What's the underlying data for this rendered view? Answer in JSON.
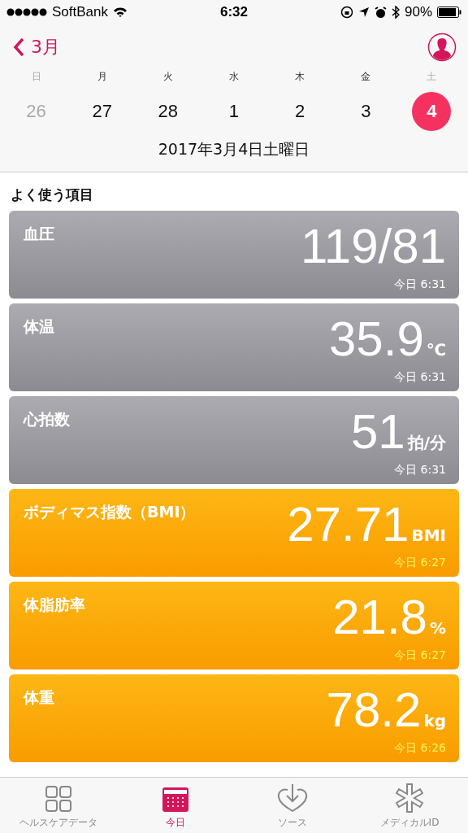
{
  "status_bar": {
    "carrier": "SoftBank",
    "time": "6:32",
    "battery": "90%"
  },
  "nav": {
    "back": "3月"
  },
  "week": [
    {
      "weekday": "日",
      "date": "26",
      "weekend": true,
      "other_month": true,
      "selected": false
    },
    {
      "weekday": "月",
      "date": "27",
      "weekend": false,
      "other_month": false,
      "selected": false
    },
    {
      "weekday": "火",
      "date": "28",
      "weekend": false,
      "other_month": false,
      "selected": false
    },
    {
      "weekday": "水",
      "date": "1",
      "weekend": false,
      "other_month": false,
      "selected": false
    },
    {
      "weekday": "木",
      "date": "2",
      "weekend": false,
      "other_month": false,
      "selected": false
    },
    {
      "weekday": "金",
      "date": "3",
      "weekend": false,
      "other_month": false,
      "selected": false
    },
    {
      "weekday": "土",
      "date": "4",
      "weekend": true,
      "other_month": false,
      "selected": true
    }
  ],
  "selected_date": "2017年3月4日土曜日",
  "section_title": "よく使う項目",
  "cards": [
    {
      "kind": "vitals",
      "title": "血圧",
      "value": "119/81",
      "time": "今日 6:31"
    },
    {
      "kind": "vitals",
      "title": "体温",
      "value": "35.9",
      "unit": "℃",
      "time": "今日 6:31"
    },
    {
      "kind": "vitals",
      "title": "心拍数",
      "value": "51",
      "unit": "拍/分",
      "time": "今日 6:31"
    },
    {
      "kind": "body",
      "title": "ボディマス指数（BMI）",
      "value": "27.71",
      "unit": "BMI",
      "time": "今日 6:27"
    },
    {
      "kind": "body",
      "title": "体脂肪率",
      "value": "21.8",
      "unit": "%",
      "time": "今日 6:27"
    },
    {
      "kind": "body",
      "title": "体重",
      "value": "78.2",
      "unit": "kg",
      "time": "今日 6:26"
    }
  ],
  "tabs": [
    {
      "kind": "grid",
      "label": "ヘルスケアデータ",
      "selected": false
    },
    {
      "kind": "calendar",
      "label": "今日",
      "selected": true
    },
    {
      "kind": "heart",
      "label": "ソース",
      "selected": false
    },
    {
      "kind": "asterisk",
      "label": "メディカルID",
      "selected": false
    }
  ]
}
